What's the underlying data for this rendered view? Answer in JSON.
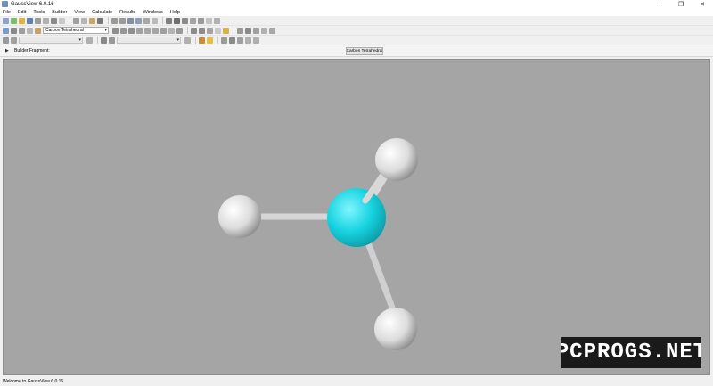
{
  "window": {
    "title": "GaussView 6.0.16"
  },
  "window_controls": {
    "minimize": "–",
    "maximize": "❐",
    "close": "✕"
  },
  "menu": [
    "File",
    "Edit",
    "Tools",
    "Builder",
    "View",
    "Calculate",
    "Results",
    "Windows",
    "Help"
  ],
  "toolbar2": {
    "fragment_combo": "Carbon Tetrahedral"
  },
  "builder": {
    "label": "Builder Fragment:",
    "selected_fragment": "Carbon Tetrahedral",
    "expand_icon": "triangle-right-icon"
  },
  "molecule": {
    "atoms": [
      {
        "name": "carbon-atom",
        "element": "C",
        "color": "#22d6e0"
      },
      {
        "name": "hydrogen-atom-top",
        "element": "H",
        "color": "#e8e8e8"
      },
      {
        "name": "hydrogen-atom-left",
        "element": "H",
        "color": "#e8e8e8"
      },
      {
        "name": "hydrogen-atom-bottom",
        "element": "H",
        "color": "#e8e8e8"
      }
    ],
    "bond_color": "#d8d8d8",
    "background": "#a5a5a5"
  },
  "watermark": "PCPROGS.NET",
  "status": {
    "text": "Welcome to GaussView 6.0.16"
  }
}
